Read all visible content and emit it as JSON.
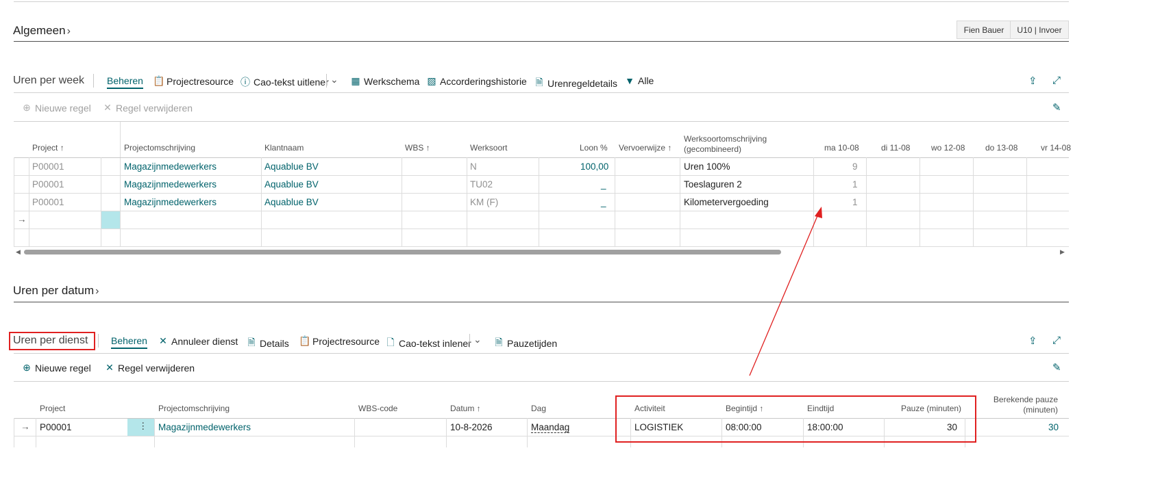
{
  "general": {
    "title": "Algemeen",
    "user_button": "Fien Bauer",
    "mode_button": "U10 | Invoer"
  },
  "week": {
    "title": "Uren per week",
    "actions": {
      "manage": "Beheren",
      "resource": "Projectresource",
      "cao": "Cao-tekst uitlener",
      "schedule": "Werkschema",
      "history": "Accorderingshistorie",
      "details": "Urenregeldetails",
      "all": "Alle"
    },
    "sub_actions": {
      "new_line": "Nieuwe regel",
      "delete_line": "Regel verwijderen"
    },
    "columns": [
      "Project",
      "Projectomschrijving",
      "Klantnaam",
      "WBS",
      "Werksoort",
      "Loon %",
      "Vervoerwijze",
      "Werksoortomschrijving",
      "(gecombineerd)",
      "ma 10-08",
      "di 11-08",
      "wo 12-08",
      "do 13-08",
      "vr 14-08"
    ],
    "rows": [
      {
        "project": "P00001",
        "desc": "Magazijnmedewerkers",
        "client": "Aquablue BV",
        "worktype": "N",
        "wage": "100,00",
        "worktype_desc": "Uren 100%",
        "mon": "9"
      },
      {
        "project": "P00001",
        "desc": "Magazijnmedewerkers",
        "client": "Aquablue BV",
        "worktype": "TU02",
        "wage": "_",
        "worktype_desc": "Toeslaguren 2",
        "mon": "1"
      },
      {
        "project": "P00001",
        "desc": "Magazijnmedewerkers",
        "client": "Aquablue BV",
        "worktype": "KM (F)",
        "wage": "_",
        "worktype_desc": "Kilometervergoeding",
        "mon": "1"
      }
    ]
  },
  "date": {
    "title": "Uren per datum"
  },
  "shift": {
    "title": "Uren per dienst",
    "actions": {
      "manage": "Beheren",
      "cancel": "Annuleer dienst",
      "details": "Details",
      "resource": "Projectresource",
      "cao": "Cao-tekst inlener",
      "breaks": "Pauzetijden"
    },
    "sub_actions": {
      "new_line": "Nieuwe regel",
      "delete_line": "Regel verwijderen"
    },
    "columns": {
      "project": "Project",
      "desc": "Projectomschrijving",
      "wbs": "WBS-code",
      "date": "Datum",
      "day": "Dag",
      "activity": "Activiteit",
      "start": "Begintijd",
      "end": "Eindtijd",
      "pause": "Pauze (minuten)",
      "calc_pause_1": "Berekende pauze",
      "calc_pause_2": "(minuten)"
    },
    "row": {
      "project": "P00001",
      "desc": "Magazijnmedewerkers",
      "date": "10-8-2026",
      "day": "Maandag",
      "activity": "LOGISTIEK",
      "start": "08:00:00",
      "end": "18:00:00",
      "pause": "30",
      "calc_pause": "30"
    }
  },
  "colors": {
    "accent": "#00626b",
    "highlight": "#e02020",
    "selected_cell": "#b4e6ea"
  }
}
